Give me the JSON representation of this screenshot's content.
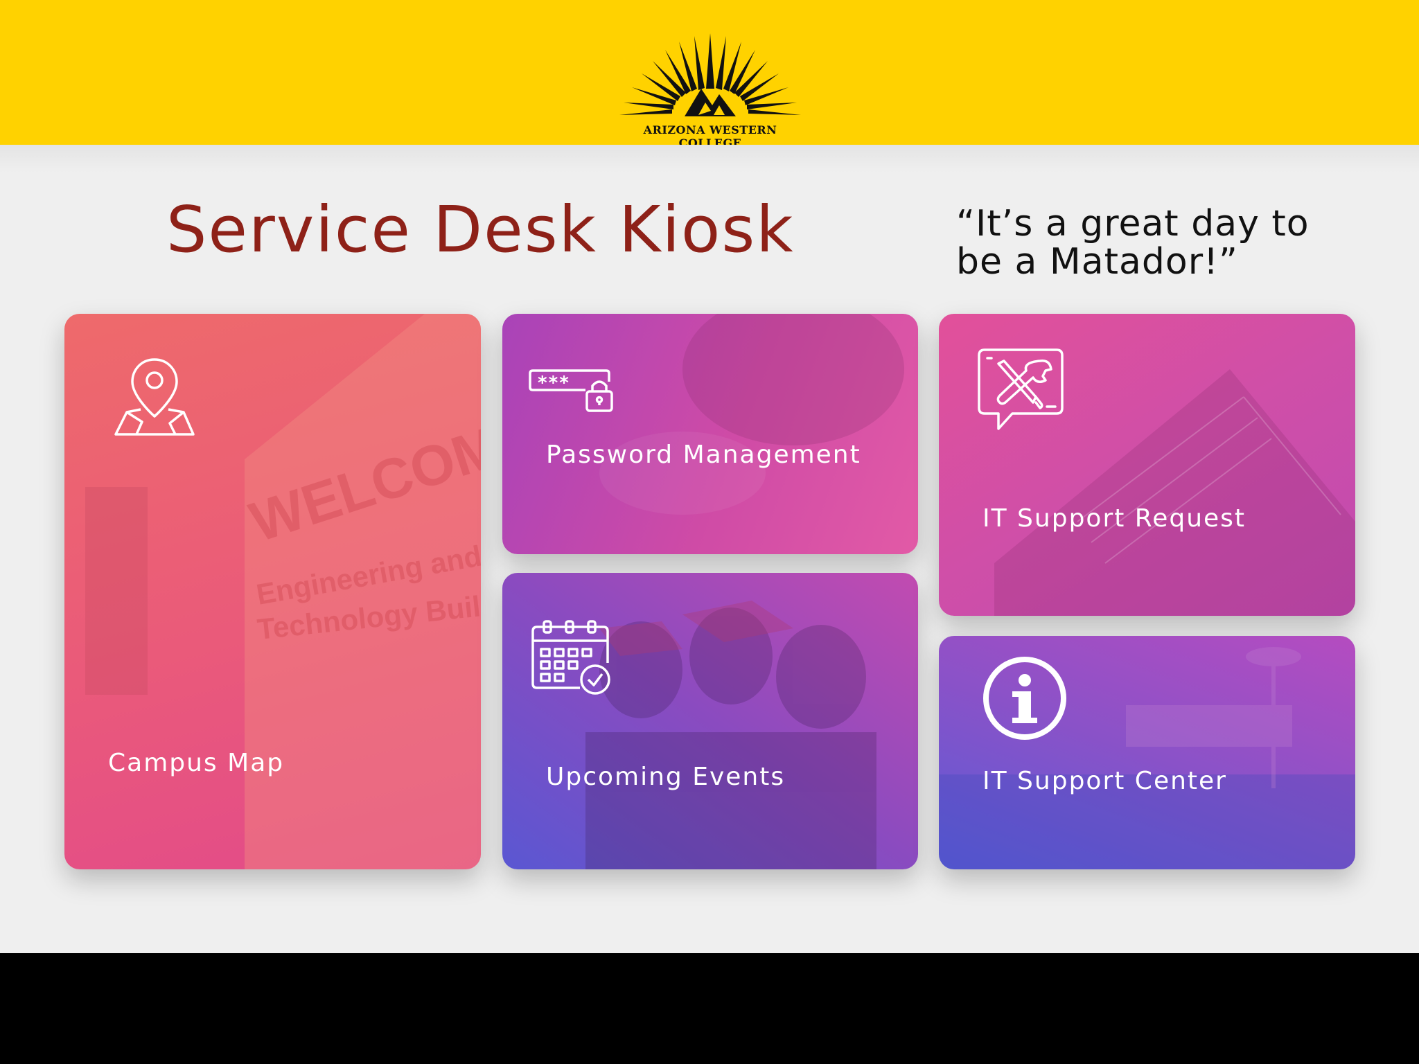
{
  "header": {
    "logo_text": "Arizona Western College",
    "background_color": "#FFD200"
  },
  "main": {
    "title": "Service Desk Kiosk",
    "slogan": "“It’s a great day to be a Matador!”",
    "title_color": "#8E2118"
  },
  "tiles": {
    "campus_map": {
      "label": "Campus Map",
      "icon": "map-pin-icon"
    },
    "password": {
      "label": "Password Management",
      "icon": "password-lock-icon"
    },
    "events": {
      "label": "Upcoming Events",
      "icon": "calendar-check-icon"
    },
    "it_request": {
      "label": "IT Support Request",
      "icon": "tools-chat-icon"
    },
    "it_center": {
      "label": "IT Support Center",
      "icon": "info-icon"
    }
  },
  "map_background": {
    "welcome": "WELCOME",
    "line1": "Engineering and",
    "line2": "Technology Building"
  }
}
